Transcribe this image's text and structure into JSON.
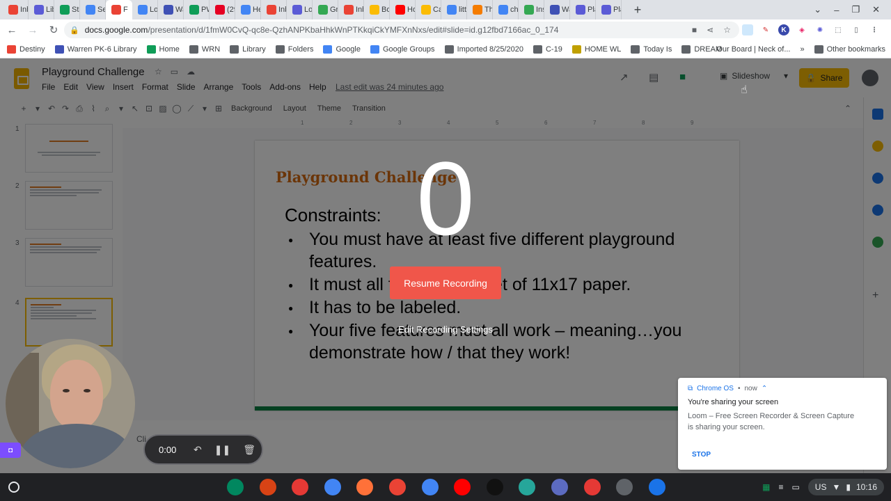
{
  "tabs": [
    {
      "label": "Inb",
      "icon": "gmail-icon",
      "color": "#ea4335"
    },
    {
      "label": "Lib",
      "icon": "puzzle-icon",
      "color": "#5b5bd6"
    },
    {
      "label": "Sta",
      "icon": "sheets-icon",
      "color": "#0f9d58"
    },
    {
      "label": "Se",
      "icon": "drive-icon",
      "color": "#4285f4"
    },
    {
      "label": "F",
      "icon": "recording-icon",
      "color": "#ea4335",
      "active": true
    },
    {
      "label": "Lo",
      "icon": "docs-icon",
      "color": "#4285f4"
    },
    {
      "label": "Wa",
      "icon": "forms-icon",
      "color": "#3f51b5"
    },
    {
      "label": "PW",
      "icon": "sheets-icon",
      "color": "#0f9d58"
    },
    {
      "label": "(29",
      "icon": "pinterest-icon",
      "color": "#e60023"
    },
    {
      "label": "He",
      "icon": "classroom-icon",
      "color": "#4285f4"
    },
    {
      "label": "Inb",
      "icon": "gmail-icon",
      "color": "#ea4335"
    },
    {
      "label": "Lo",
      "icon": "puzzle-icon",
      "color": "#5b5bd6"
    },
    {
      "label": "Gr",
      "icon": "drive-icon",
      "color": "#34a853"
    },
    {
      "label": "Inb",
      "icon": "gmail-icon",
      "color": "#ea4335"
    },
    {
      "label": "Bo",
      "icon": "blank-icon",
      "color": "#fbbc04"
    },
    {
      "label": "Ho",
      "icon": "youtube-icon",
      "color": "#ff0000"
    },
    {
      "label": "Ca",
      "icon": "keep-icon",
      "color": "#fbbc04"
    },
    {
      "label": "litt",
      "icon": "google-icon",
      "color": "#4285f4"
    },
    {
      "label": "Th",
      "icon": "pear-icon",
      "color": "#f57c00"
    },
    {
      "label": "ch",
      "icon": "google-icon",
      "color": "#4285f4"
    },
    {
      "label": "Ins",
      "icon": "x-icon",
      "color": "#34a853"
    },
    {
      "label": "Wa",
      "icon": "forms-icon",
      "color": "#3f51b5"
    },
    {
      "label": "Pla",
      "icon": "puzzle-icon",
      "color": "#5b5bd6"
    },
    {
      "label": "Pla",
      "icon": "puzzle-icon",
      "color": "#5b5bd6"
    }
  ],
  "address": {
    "url_host": "docs.google.com",
    "url_path": "/presentation/d/1fmW0CvQ-qc8e-QzhANPKbaHhkWnPTKkqiCkYMFXnNxs/edit#slide=id.g12fbd7166ac_0_174"
  },
  "bookmarks": [
    {
      "label": "Destiny",
      "color": "#ea4335"
    },
    {
      "label": "Warren PK-6 Library",
      "color": "#3f51b5"
    },
    {
      "label": "Home",
      "color": "#0f9d58"
    },
    {
      "label": "WRN",
      "color": "#5f6368"
    },
    {
      "label": "Library",
      "color": "#5f6368"
    },
    {
      "label": "Folders",
      "color": "#5f6368"
    },
    {
      "label": "Google",
      "color": "#4285f4"
    },
    {
      "label": "Google Groups",
      "color": "#4285f4"
    },
    {
      "label": "Imported 8/25/2020",
      "color": "#5f6368"
    },
    {
      "label": "C-19",
      "color": "#5f6368"
    },
    {
      "label": "HOME WL",
      "color": "#c0a000"
    },
    {
      "label": "Today Is",
      "color": "#5f6368"
    },
    {
      "label": "DREAM",
      "color": "#5f6368"
    }
  ],
  "bookmarks_right": {
    "board": "Our Board | Neck of...",
    "more": "»",
    "other": "Other bookmarks"
  },
  "slides": {
    "doc_title": "Playground Challenge",
    "menu": [
      "File",
      "Edit",
      "View",
      "Insert",
      "Format",
      "Slide",
      "Arrange",
      "Tools",
      "Add-ons",
      "Help"
    ],
    "last_edit": "Last edit was 24 minutes ago",
    "slideshow_label": "Slideshow",
    "share_label": "Share",
    "toolbar": {
      "background": "Background",
      "layout": "Layout",
      "theme": "Theme",
      "transition": "Transition"
    },
    "ruler": [
      "1",
      "2",
      "3",
      "4",
      "5",
      "6",
      "7",
      "8",
      "9"
    ],
    "thumb_numbers": [
      "1",
      "2",
      "3",
      "4"
    ],
    "slide": {
      "title": "Playground Challenge",
      "constraints": "Constraints:",
      "bullets": [
        "You must have at least five different playground features.",
        "It must all fit on one sheet of 11x17 paper.",
        "It has to be labeled.",
        "Your five features must all work – meaning…you demonstrate how / that they work!"
      ]
    },
    "speaker_notes": "Cli"
  },
  "loom": {
    "countdown": "0",
    "resume_label": "Resume Recording",
    "settings_label": "Edit Recording Settings",
    "timer": "0:00"
  },
  "notification": {
    "source": "Chrome OS",
    "time": "now",
    "title": "You're sharing your screen",
    "body": "Loom – Free Screen Recorder & Screen Capture is sharing your screen.",
    "stop_label": "STOP"
  },
  "shelf": {
    "apps": [
      {
        "name": "play-store-icon",
        "color": "#01875f"
      },
      {
        "name": "pencil-app-icon",
        "color": "#d84315"
      },
      {
        "name": "screencastify-icon",
        "color": "#e53935"
      },
      {
        "name": "chrome-icon",
        "color": "#4285f4"
      },
      {
        "name": "firefox-icon",
        "color": "#ff7139"
      },
      {
        "name": "gmail-icon",
        "color": "#ea4335"
      },
      {
        "name": "docs-icon",
        "color": "#4285f4"
      },
      {
        "name": "youtube-icon",
        "color": "#ff0000"
      },
      {
        "name": "tiktok-icon",
        "color": "#111111"
      },
      {
        "name": "edu-app-icon",
        "color": "#26a69a"
      },
      {
        "name": "drive-app-icon",
        "color": "#5c6bc0"
      },
      {
        "name": "screenshot-app-icon",
        "color": "#e53935"
      },
      {
        "name": "settings-icon",
        "color": "#5f6368"
      },
      {
        "name": "files-icon",
        "color": "#1a73e8"
      }
    ],
    "locale": "US",
    "clock": "10:16"
  }
}
